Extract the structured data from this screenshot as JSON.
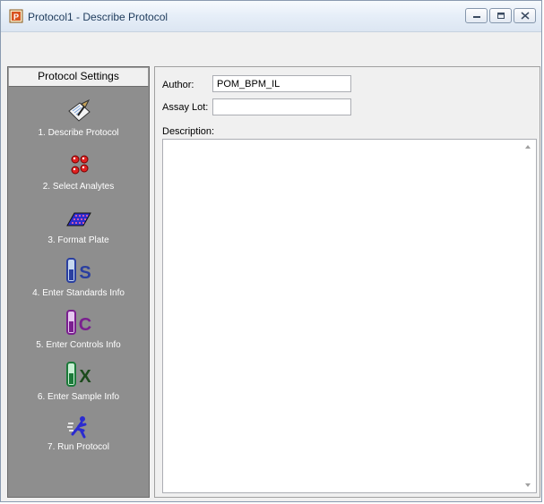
{
  "window": {
    "title": "Protocol1 - Describe Protocol",
    "buttons": [
      "minimize",
      "maximize",
      "close"
    ]
  },
  "sidebar": {
    "header": "Protocol Settings",
    "steps": [
      {
        "label": "1. Describe Protocol",
        "icon": "notepad-pen-icon"
      },
      {
        "label": "2. Select Analytes",
        "icon": "beads-icon"
      },
      {
        "label": "3. Format Plate",
        "icon": "plate-icon"
      },
      {
        "label": "4. Enter Standards Info",
        "icon": "standards-tube-icon"
      },
      {
        "label": "5. Enter Controls Info",
        "icon": "controls-tube-icon"
      },
      {
        "label": "6. Enter Sample Info",
        "icon": "sample-tube-icon"
      },
      {
        "label": "7. Run Protocol",
        "icon": "runner-icon"
      }
    ]
  },
  "form": {
    "author_label": "Author:",
    "author_value": "POM_BPM_IL",
    "assay_lot_label": "Assay Lot:",
    "assay_lot_value": "",
    "description_label": "Description:",
    "description_value": ""
  },
  "icon_letters": {
    "standards": "S",
    "controls": "C",
    "sample": "X"
  },
  "colors": {
    "sidebar_bg": "#8e8e8e",
    "window_bg": "#f0f0f0",
    "standards": "#2a3fa0",
    "controls": "#7a1f8f",
    "sample": "#1c7a3a"
  }
}
